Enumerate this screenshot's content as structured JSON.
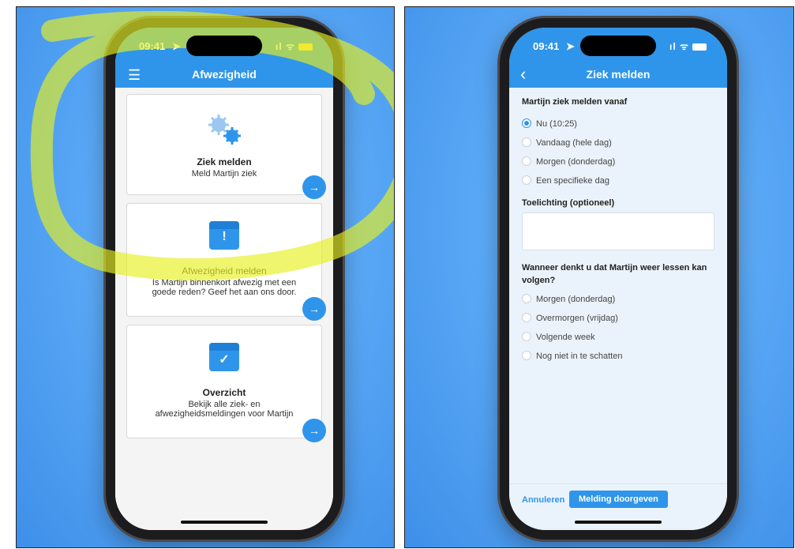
{
  "left_screen": {
    "status_time": "09:41",
    "status_icons": "ıl ᯤ",
    "menu_icon_glyph": "☰",
    "nav_title": "Afwezigheid",
    "cards": [
      {
        "title": "Ziek melden",
        "subtitle": "Meld Martijn ziek",
        "icon": "gears-icon",
        "arrow": "→"
      },
      {
        "title": "Afwezigheid melden",
        "subtitle": "Is Martijn binnenkort afwezig met een goede reden? Geef het aan ons door.",
        "icon": "calendar-alert-icon",
        "icon_glyph": "!",
        "arrow": "→"
      },
      {
        "title": "Overzicht",
        "subtitle": "Bekijk alle ziek- en afwezigheidsmeldingen voor Martijn",
        "icon": "calendar-check-icon",
        "icon_glyph": "✓",
        "arrow": "→"
      }
    ]
  },
  "right_screen": {
    "status_time": "09:41",
    "status_icons": "ıl ᯤ",
    "back_glyph": "‹",
    "nav_title": "Ziek melden",
    "from_question": "Martijn ziek melden vanaf",
    "from_options": [
      "Nu (10:25)",
      "Vandaag (hele dag)",
      "Morgen (donderdag)",
      "Een specifieke dag"
    ],
    "from_selected": 0,
    "note_label": "Toelichting (optioneel)",
    "note_value": "",
    "return_question": "Wanneer denkt u dat Martijn weer lessen kan volgen?",
    "return_options": [
      "Morgen (donderdag)",
      "Overmorgen (vrijdag)",
      "Volgende week",
      "Nog niet in te schatten"
    ],
    "cancel_label": "Annuleren",
    "submit_label": "Melding doorgeven"
  },
  "colors": {
    "accent": "#2f95ea",
    "highlight": "#e6f01f",
    "background": "#5aa9f7"
  }
}
